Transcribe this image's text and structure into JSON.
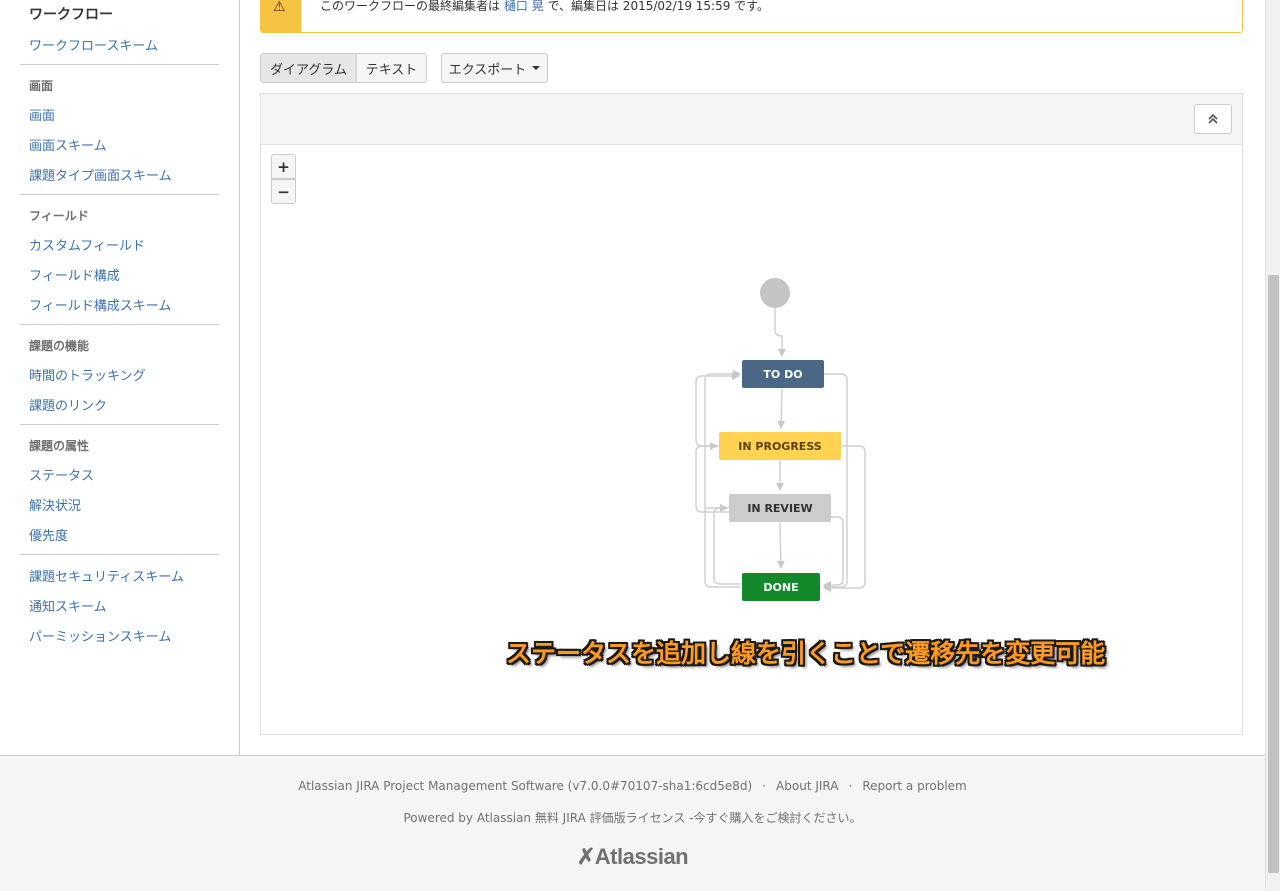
{
  "sidebar": {
    "title": "ワークフロー",
    "workflow_scheme": "ワークフロースキーム",
    "sections": [
      {
        "heading": "画面",
        "items": [
          "画面",
          "画面スキーム",
          "課題タイプ画面スキーム"
        ]
      },
      {
        "heading": "フィールド",
        "items": [
          "カスタムフィールド",
          "フィールド構成",
          "フィールド構成スキーム"
        ]
      },
      {
        "heading": "課題の機能",
        "items": [
          "時間のトラッキング",
          "課題のリンク"
        ]
      },
      {
        "heading": "課題の属性",
        "items": [
          "ステータス",
          "解決状況",
          "優先度"
        ]
      },
      {
        "heading": "",
        "items": [
          "課題セキュリティスキーム",
          "通知スキーム",
          "パーミッションスキーム"
        ]
      }
    ]
  },
  "warning": {
    "text_before": "このワークフローの最終編集者は ",
    "editor": "樋口 晃",
    "text_after": " で、編集日は 2015/02/19 15:59 です。"
  },
  "toolbar": {
    "diagram_label": "ダイアグラム",
    "text_label": "テキスト",
    "export_label": "エクスポート"
  },
  "zoom": {
    "in": "+",
    "out": "−"
  },
  "statuses": [
    {
      "id": "todo",
      "label": "TO DO",
      "bg": "#4a6785",
      "fg": "#ffffff"
    },
    {
      "id": "inprogress",
      "label": "IN PROGRESS",
      "bg": "#ffd351",
      "fg": "#594300"
    },
    {
      "id": "inreview",
      "label": "IN REVIEW",
      "bg": "#cccccc",
      "fg": "#333333"
    },
    {
      "id": "done",
      "label": "DONE",
      "bg": "#14892c",
      "fg": "#ffffff"
    }
  ],
  "annotation": "ステータスを追加し線を引くことで遷移先を変更可能",
  "footer": {
    "software": "Atlassian JIRA Project Management Software (v7.0.0#70107-sha1:6cd5e8d)",
    "about": "About JIRA",
    "report": "Report a problem",
    "powered": "Powered by Atlassian 無料 JIRA 評価版ライセンス -今すぐ購入をご検討ください。",
    "logo": "Atlassian"
  },
  "colors": {
    "link": "#3b73af",
    "warning_border": "#f6c342",
    "annotation_text": "#ff9a1f"
  }
}
